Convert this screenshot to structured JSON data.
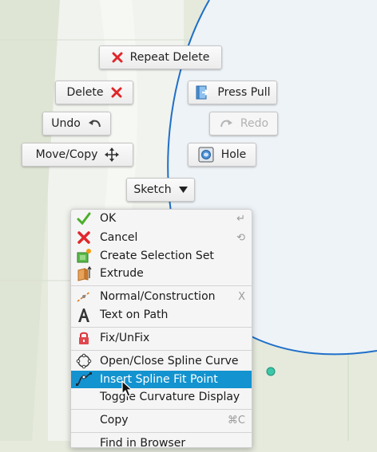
{
  "colors": {
    "background": "#e5eadd",
    "canvas_light": "#f2f4ee",
    "circle_fill": "#eef3f7",
    "sketch_line": "#1f6fc8",
    "highlight": "#1393cf",
    "delete_red": "#e0262a",
    "fit_point": "#3cc8a8"
  },
  "marking_menu": {
    "repeat_delete": "Repeat Delete",
    "delete": "Delete",
    "press_pull": "Press Pull",
    "undo": "Undo",
    "redo": "Redo",
    "move_copy": "Move/Copy",
    "hole": "Hole",
    "sketch": "Sketch"
  },
  "context_menu": {
    "items": [
      {
        "label": "OK",
        "icon": "check-icon",
        "shortcut": "↵"
      },
      {
        "label": "Cancel",
        "icon": "cancel-x-icon",
        "shortcut": "⟲"
      },
      {
        "label": "Create Selection Set",
        "icon": "selection-set-icon",
        "shortcut": ""
      },
      {
        "label": "Extrude",
        "icon": "extrude-icon",
        "shortcut": ""
      },
      {
        "label": "Normal/Construction",
        "icon": "construction-line-icon",
        "shortcut": "X"
      },
      {
        "label": "Text on Path",
        "icon": "text-a-icon",
        "shortcut": ""
      },
      {
        "label": "Fix/UnFix",
        "icon": "lock-icon",
        "shortcut": ""
      },
      {
        "label": "Open/Close Spline Curve",
        "icon": "spline-close-icon",
        "shortcut": ""
      },
      {
        "label": "Insert Spline Fit Point",
        "icon": "spline-fit-point-icon",
        "shortcut": ""
      },
      {
        "label": "Toggle Curvature Display",
        "icon": "",
        "shortcut": ""
      },
      {
        "label": "Copy",
        "icon": "",
        "shortcut": "⌘C"
      },
      {
        "label": "Find in Browser",
        "icon": "",
        "shortcut": ""
      }
    ],
    "highlighted_index": 8
  }
}
